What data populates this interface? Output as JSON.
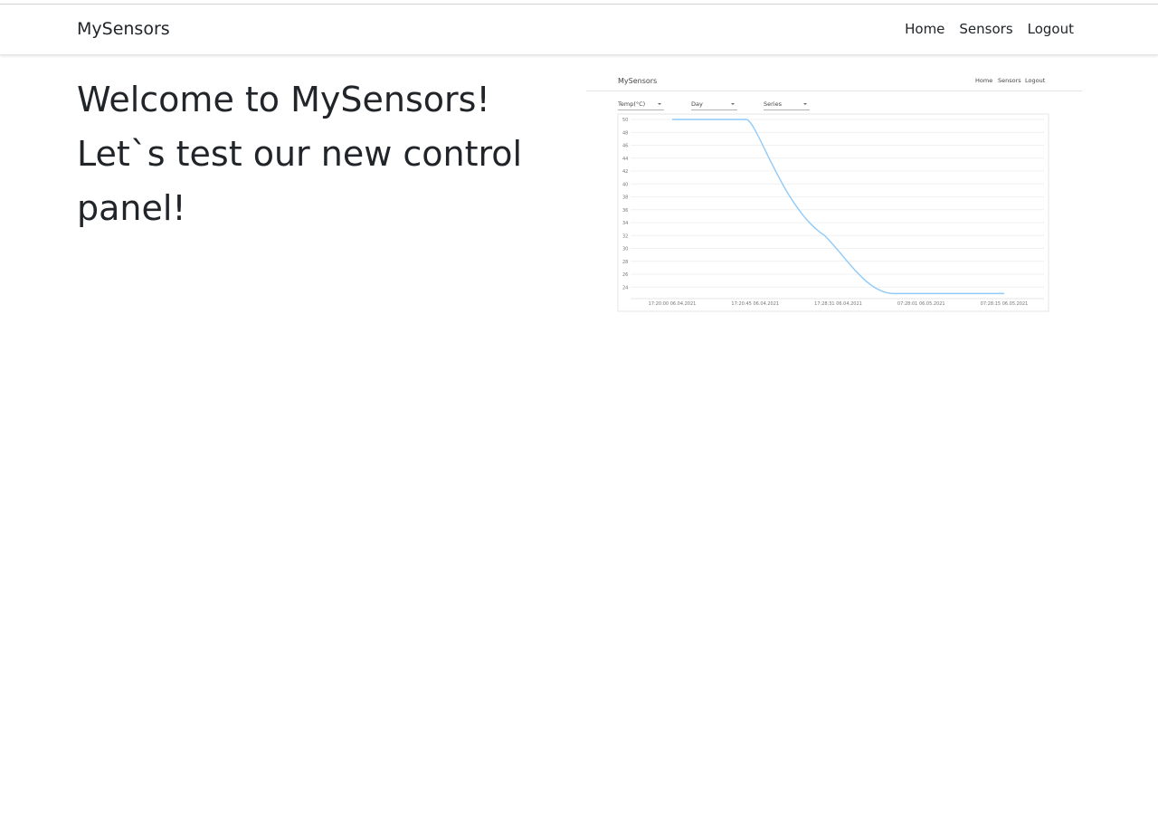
{
  "navbar": {
    "brand": "MySensors",
    "links": [
      "Home",
      "Sensors",
      "Logout"
    ]
  },
  "main": {
    "headline": "Welcome to MySensors! Let`s test our new control panel!"
  },
  "preview": {
    "brand": "MySensors",
    "nav_links": [
      "Home",
      "Sensors",
      "Logout"
    ],
    "selects": [
      "Temp(°C)",
      "Day",
      "Series"
    ],
    "chart_data": {
      "type": "line",
      "series": [
        {
          "values": [
            {
              "x": "17:20:00 06.04.2021",
              "y": 50
            },
            {
              "x": "17:20:45 06.04.2021",
              "y": 50
            },
            {
              "x": "17:28:31 06.04.2021",
              "y": 32
            },
            {
              "x": "07:28:01 06.05.2021",
              "y": 23
            },
            {
              "x": "07:28:15 06.05.2021",
              "y": 23
            }
          ]
        }
      ],
      "y_ticks": [
        50,
        48,
        46,
        44,
        42,
        40,
        38,
        36,
        34,
        32,
        30,
        28,
        26,
        24
      ],
      "x_ticks": [
        "17:20:00 06.04.2021",
        "17:20:45 06.04.2021",
        "17:28:31 06.04.2021",
        "07:28:01 06.05.2021",
        "07:28:15 06.05.2021"
      ],
      "ylim": [
        23,
        50
      ],
      "grid": true,
      "line_color": "#90caf9"
    }
  }
}
